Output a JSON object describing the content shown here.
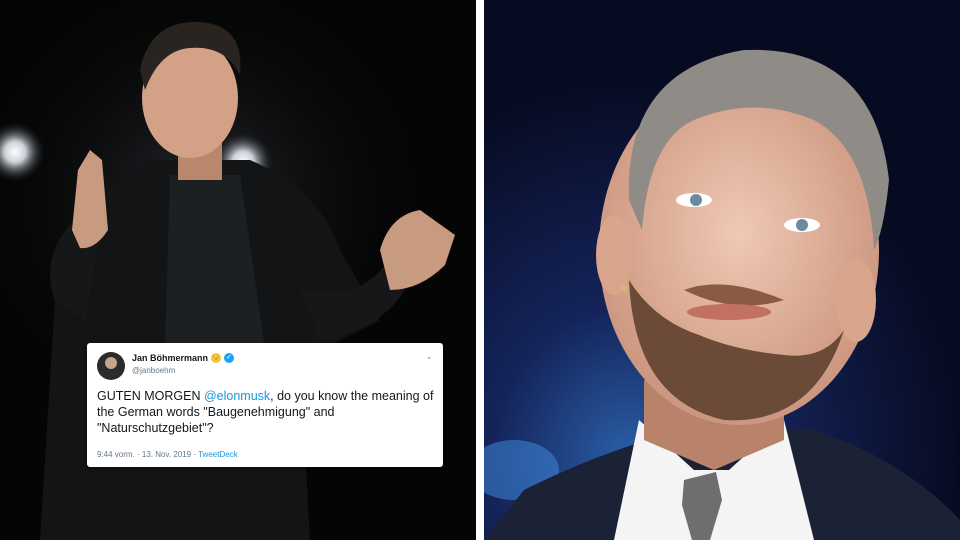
{
  "image": {
    "left_photo": {
      "subject": "man-speaking-on-stage"
    },
    "right_photo": {
      "subject": "bearded-man-smiling"
    }
  },
  "tweet": {
    "display_name": "Jan Böhmermann",
    "name_emoji": "😏",
    "verified_icon": "verified-badge-icon",
    "handle": "@janboehm",
    "text_before": "GUTEN MORGEN ",
    "mention": "@elonmusk",
    "text_after": ", do you know the meaning of the German words \"Baugenehmigung\" and \"Naturschutzgebiet\"?",
    "time": "9:44 vorm.",
    "separator": " · ",
    "date": "13. Nov. 2019",
    "source": "TweetDeck",
    "menu_icon": "chevron-down-icon"
  },
  "colors": {
    "twitter_blue": "#1da1f2",
    "link_blue": "#1b95e0",
    "left_bg": "#050505",
    "right_bg": "#0b1230"
  }
}
